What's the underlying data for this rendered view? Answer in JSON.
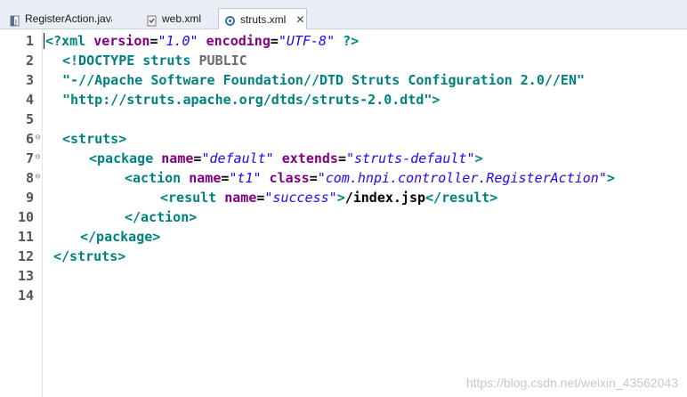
{
  "tabs": [
    {
      "label": "RegisterAction.java",
      "icon": "java-file-icon",
      "active": false
    },
    {
      "label": "web.xml",
      "icon": "xml-file-icon",
      "active": false
    },
    {
      "label": "struts.xml",
      "icon": "struts-config-icon",
      "active": true,
      "close": "✕"
    }
  ],
  "editor": {
    "lines": [
      {
        "num": "1",
        "l1": "<?xml ",
        "l2": "version",
        "l3": "=",
        "l4": "\"1.0\"",
        "l5": " encoding",
        "l6": "=",
        "l7": "\"UTF-8\"",
        "l8": " ?>"
      },
      {
        "num": "2",
        "a": "<!DOCTYPE struts ",
        "b": "PUBLIC"
      },
      {
        "num": "3",
        "a": "\"-//Apache Software Foundation//DTD Struts Configuration 2.0//EN\""
      },
      {
        "num": "4",
        "a": "\"http://struts.apache.org/dtds/struts-2.0.dtd\"",
        "b": ">"
      },
      {
        "num": "5"
      },
      {
        "num": "6",
        "a": "<struts>"
      },
      {
        "num": "7",
        "a": "<package ",
        "b": "name",
        "c": "=",
        "d": "\"default\"",
        "e": " extends",
        "f": "=",
        "g": "\"struts-default\"",
        "h": ">"
      },
      {
        "num": "8",
        "a": "<action ",
        "b": "name",
        "c": "=",
        "d": "\"t1\"",
        "e": " class",
        "f": "=",
        "g": "\"com.hnpi.controller.RegisterAction\"",
        "h": ">"
      },
      {
        "num": "9",
        "a": "<result ",
        "b": "name",
        "c": "=",
        "d": "\"success\"",
        "e": ">",
        "f": "/index.jsp",
        "g": "</result>"
      },
      {
        "num": "10",
        "a": "</action>"
      },
      {
        "num": "11",
        "a": "</package>"
      },
      {
        "num": "12",
        "a": "</struts>"
      },
      {
        "num": "13"
      },
      {
        "num": "14"
      }
    ]
  },
  "watermark": "https://blog.csdn.net/weixin_43562043",
  "colors": {
    "tag": "#008080",
    "attribute": "#7f007f",
    "attribute_value": "#2a00ff",
    "tab_bar": "#e9eef5"
  }
}
